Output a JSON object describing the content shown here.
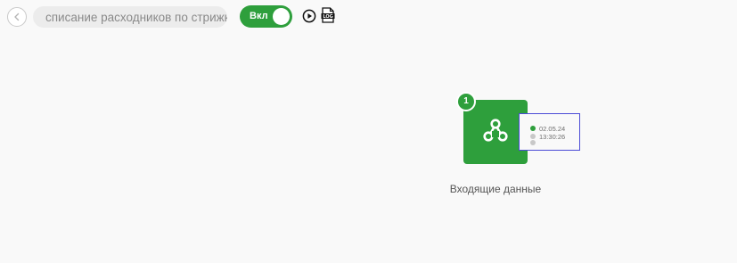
{
  "toolbar": {
    "back_icon": "chevron-left-icon",
    "title_value": "списание расходников по стрижке",
    "toggle_label": "Вкл",
    "toggle_state": "on",
    "play_icon": "play-circle-icon",
    "log_icon": "log-file-icon",
    "log_icon_text": "LOG"
  },
  "node": {
    "badge": "1",
    "icon": "webhook-icon",
    "label": "Входящие данные",
    "status": {
      "date": "02.05.24",
      "time": "13:30:26"
    }
  },
  "colors": {
    "accent": "#2e9f3c",
    "selection": "#4b4bd6",
    "background": "#f9f9f9",
    "input_bg": "#ececec",
    "muted_dot": "#c8c8c8"
  }
}
